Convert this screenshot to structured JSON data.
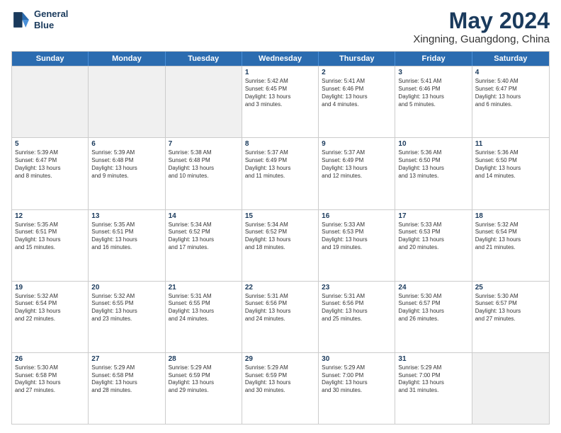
{
  "header": {
    "logo_line1": "General",
    "logo_line2": "Blue",
    "month": "May 2024",
    "location": "Xingning, Guangdong, China"
  },
  "weekdays": [
    "Sunday",
    "Monday",
    "Tuesday",
    "Wednesday",
    "Thursday",
    "Friday",
    "Saturday"
  ],
  "rows": [
    [
      {
        "day": "",
        "text": "",
        "shaded": true
      },
      {
        "day": "",
        "text": "",
        "shaded": true
      },
      {
        "day": "",
        "text": "",
        "shaded": true
      },
      {
        "day": "1",
        "text": "Sunrise: 5:42 AM\nSunset: 6:45 PM\nDaylight: 13 hours\nand 3 minutes."
      },
      {
        "day": "2",
        "text": "Sunrise: 5:41 AM\nSunset: 6:46 PM\nDaylight: 13 hours\nand 4 minutes."
      },
      {
        "day": "3",
        "text": "Sunrise: 5:41 AM\nSunset: 6:46 PM\nDaylight: 13 hours\nand 5 minutes."
      },
      {
        "day": "4",
        "text": "Sunrise: 5:40 AM\nSunset: 6:47 PM\nDaylight: 13 hours\nand 6 minutes."
      }
    ],
    [
      {
        "day": "5",
        "text": "Sunrise: 5:39 AM\nSunset: 6:47 PM\nDaylight: 13 hours\nand 8 minutes."
      },
      {
        "day": "6",
        "text": "Sunrise: 5:39 AM\nSunset: 6:48 PM\nDaylight: 13 hours\nand 9 minutes."
      },
      {
        "day": "7",
        "text": "Sunrise: 5:38 AM\nSunset: 6:48 PM\nDaylight: 13 hours\nand 10 minutes."
      },
      {
        "day": "8",
        "text": "Sunrise: 5:37 AM\nSunset: 6:49 PM\nDaylight: 13 hours\nand 11 minutes."
      },
      {
        "day": "9",
        "text": "Sunrise: 5:37 AM\nSunset: 6:49 PM\nDaylight: 13 hours\nand 12 minutes."
      },
      {
        "day": "10",
        "text": "Sunrise: 5:36 AM\nSunset: 6:50 PM\nDaylight: 13 hours\nand 13 minutes."
      },
      {
        "day": "11",
        "text": "Sunrise: 5:36 AM\nSunset: 6:50 PM\nDaylight: 13 hours\nand 14 minutes."
      }
    ],
    [
      {
        "day": "12",
        "text": "Sunrise: 5:35 AM\nSunset: 6:51 PM\nDaylight: 13 hours\nand 15 minutes."
      },
      {
        "day": "13",
        "text": "Sunrise: 5:35 AM\nSunset: 6:51 PM\nDaylight: 13 hours\nand 16 minutes."
      },
      {
        "day": "14",
        "text": "Sunrise: 5:34 AM\nSunset: 6:52 PM\nDaylight: 13 hours\nand 17 minutes."
      },
      {
        "day": "15",
        "text": "Sunrise: 5:34 AM\nSunset: 6:52 PM\nDaylight: 13 hours\nand 18 minutes."
      },
      {
        "day": "16",
        "text": "Sunrise: 5:33 AM\nSunset: 6:53 PM\nDaylight: 13 hours\nand 19 minutes."
      },
      {
        "day": "17",
        "text": "Sunrise: 5:33 AM\nSunset: 6:53 PM\nDaylight: 13 hours\nand 20 minutes."
      },
      {
        "day": "18",
        "text": "Sunrise: 5:32 AM\nSunset: 6:54 PM\nDaylight: 13 hours\nand 21 minutes."
      }
    ],
    [
      {
        "day": "19",
        "text": "Sunrise: 5:32 AM\nSunset: 6:54 PM\nDaylight: 13 hours\nand 22 minutes."
      },
      {
        "day": "20",
        "text": "Sunrise: 5:32 AM\nSunset: 6:55 PM\nDaylight: 13 hours\nand 23 minutes."
      },
      {
        "day": "21",
        "text": "Sunrise: 5:31 AM\nSunset: 6:55 PM\nDaylight: 13 hours\nand 24 minutes."
      },
      {
        "day": "22",
        "text": "Sunrise: 5:31 AM\nSunset: 6:56 PM\nDaylight: 13 hours\nand 24 minutes."
      },
      {
        "day": "23",
        "text": "Sunrise: 5:31 AM\nSunset: 6:56 PM\nDaylight: 13 hours\nand 25 minutes."
      },
      {
        "day": "24",
        "text": "Sunrise: 5:30 AM\nSunset: 6:57 PM\nDaylight: 13 hours\nand 26 minutes."
      },
      {
        "day": "25",
        "text": "Sunrise: 5:30 AM\nSunset: 6:57 PM\nDaylight: 13 hours\nand 27 minutes."
      }
    ],
    [
      {
        "day": "26",
        "text": "Sunrise: 5:30 AM\nSunset: 6:58 PM\nDaylight: 13 hours\nand 27 minutes."
      },
      {
        "day": "27",
        "text": "Sunrise: 5:29 AM\nSunset: 6:58 PM\nDaylight: 13 hours\nand 28 minutes."
      },
      {
        "day": "28",
        "text": "Sunrise: 5:29 AM\nSunset: 6:59 PM\nDaylight: 13 hours\nand 29 minutes."
      },
      {
        "day": "29",
        "text": "Sunrise: 5:29 AM\nSunset: 6:59 PM\nDaylight: 13 hours\nand 30 minutes."
      },
      {
        "day": "30",
        "text": "Sunrise: 5:29 AM\nSunset: 7:00 PM\nDaylight: 13 hours\nand 30 minutes."
      },
      {
        "day": "31",
        "text": "Sunrise: 5:29 AM\nSunset: 7:00 PM\nDaylight: 13 hours\nand 31 minutes."
      },
      {
        "day": "",
        "text": "",
        "shaded": true
      }
    ]
  ]
}
